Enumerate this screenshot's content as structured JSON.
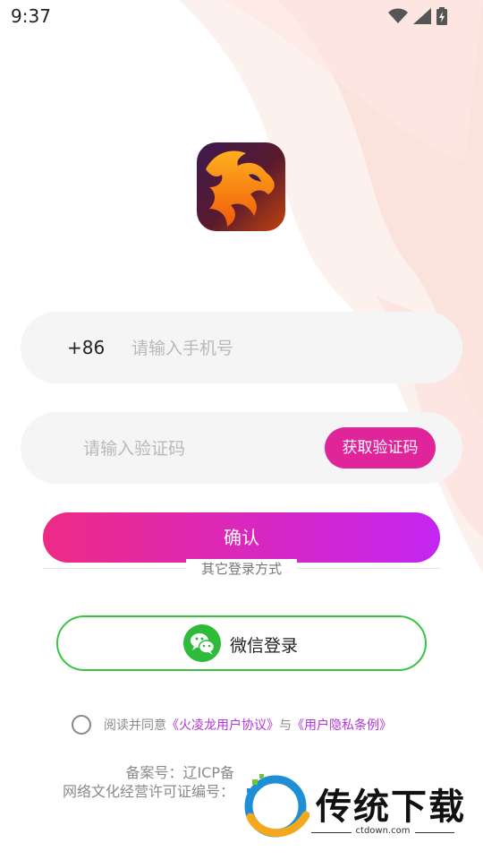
{
  "status_bar": {
    "time": "9:37"
  },
  "phone_field": {
    "country_code": "+86",
    "placeholder": "请输入手机号",
    "value": ""
  },
  "code_field": {
    "placeholder": "请输入验证码",
    "value": "",
    "get_code_label": "获取验证码"
  },
  "confirm_label": "确认",
  "other_login_label": "其它登录方式",
  "wechat_login_label": "微信登录",
  "agreement": {
    "prefix": "阅读并同意",
    "user_agreement": "《火凌龙用户协议》",
    "conjunction": "与",
    "privacy_policy": "《用户隐私条例》"
  },
  "footer": {
    "icp": "备案号：辽ICP备",
    "culture_license": "网络文化经营许可证编号："
  },
  "watermark": {
    "title": "传统下载",
    "domain": "ctdown.com"
  },
  "colors": {
    "gradient_start": "#ee2a85",
    "gradient_end": "#c425f2",
    "wechat_green": "#2dbb39",
    "link": "#b534d8"
  }
}
